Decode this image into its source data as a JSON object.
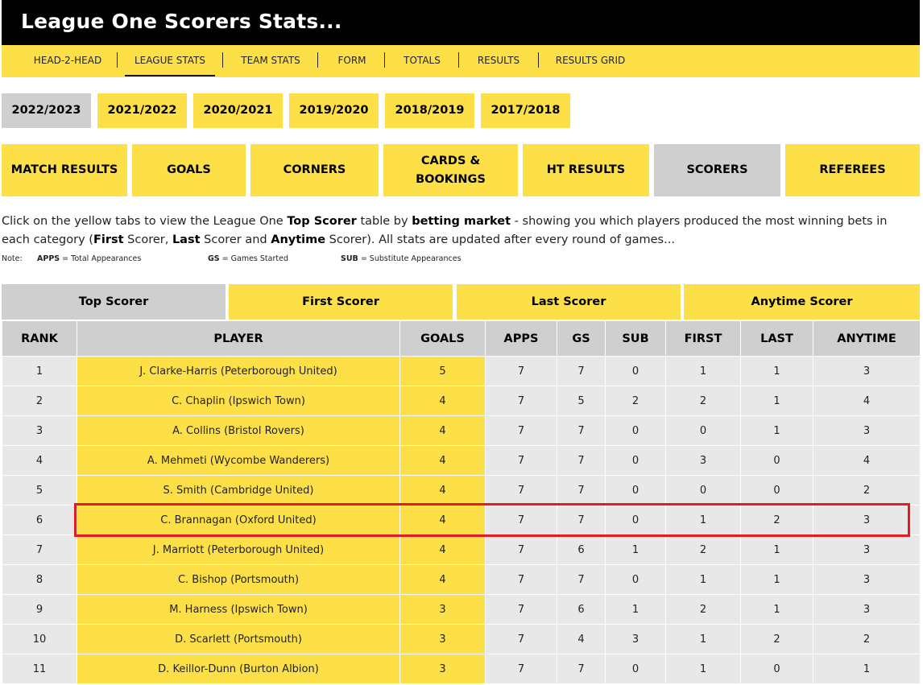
{
  "header": {
    "title": "League One Scorers Stats..."
  },
  "nav": {
    "items": [
      {
        "label": "HEAD-2-HEAD",
        "active": false
      },
      {
        "label": "LEAGUE STATS",
        "active": true
      },
      {
        "label": "TEAM STATS",
        "active": false
      },
      {
        "label": "FORM",
        "active": false
      },
      {
        "label": "TOTALS",
        "active": false
      },
      {
        "label": "RESULTS",
        "active": false
      },
      {
        "label": "RESULTS GRID",
        "active": false
      }
    ]
  },
  "seasons": [
    {
      "label": "2022/2023",
      "active": true
    },
    {
      "label": "2021/2022",
      "active": false
    },
    {
      "label": "2020/2021",
      "active": false
    },
    {
      "label": "2019/2020",
      "active": false
    },
    {
      "label": "2018/2019",
      "active": false
    },
    {
      "label": "2017/2018",
      "active": false
    }
  ],
  "categories": [
    {
      "label": "MATCH RESULTS",
      "active": false
    },
    {
      "label": "GOALS",
      "active": false
    },
    {
      "label": "CORNERS",
      "active": false
    },
    {
      "label": "CARDS & BOOKINGS",
      "active": false
    },
    {
      "label": "HT RESULTS",
      "active": false
    },
    {
      "label": "SCORERS",
      "active": true
    },
    {
      "label": "REFEREES",
      "active": false
    }
  ],
  "description": {
    "t1": "Click on the yellow tabs to view the League One ",
    "b1": "Top Scorer",
    "t2": " table by ",
    "b2": "betting market",
    "t3": " - showing you which players produced the most winning bets in each category (",
    "b3": "First",
    "t4": " Scorer, ",
    "b4": "Last",
    "t5": " Scorer and ",
    "b5": "Anytime",
    "t6": " Scorer). All stats are updated after every round of games..."
  },
  "note": {
    "prefix": "Note:",
    "apps_key": "APPS",
    "apps_text": " = Total Appearances",
    "gs_key": "GS",
    "gs_text": " = Games Started",
    "sub_key": "SUB",
    "sub_text": " = Substitute Appearances"
  },
  "sub_tabs": [
    {
      "label": "Top Scorer",
      "active": true
    },
    {
      "label": "First Scorer",
      "active": false
    },
    {
      "label": "Last Scorer",
      "active": false
    },
    {
      "label": "Anytime Scorer",
      "active": false
    }
  ],
  "table": {
    "headers": [
      "RANK",
      "PLAYER",
      "GOALS",
      "APPS",
      "GS",
      "SUB",
      "FIRST",
      "LAST",
      "ANYTIME"
    ],
    "rows": [
      [
        "1",
        "J. Clarke-Harris (Peterborough United)",
        "5",
        "7",
        "7",
        "0",
        "1",
        "1",
        "3"
      ],
      [
        "2",
        "C. Chaplin (Ipswich Town)",
        "4",
        "7",
        "5",
        "2",
        "2",
        "1",
        "4"
      ],
      [
        "3",
        "A. Collins (Bristol Rovers)",
        "4",
        "7",
        "7",
        "0",
        "0",
        "1",
        "3"
      ],
      [
        "4",
        "A. Mehmeti (Wycombe Wanderers)",
        "4",
        "7",
        "7",
        "0",
        "3",
        "0",
        "4"
      ],
      [
        "5",
        "S. Smith (Cambridge United)",
        "4",
        "7",
        "7",
        "0",
        "0",
        "0",
        "2"
      ],
      [
        "6",
        "C. Brannagan (Oxford United)",
        "4",
        "7",
        "7",
        "0",
        "1",
        "2",
        "3"
      ],
      [
        "7",
        "J. Marriott (Peterborough United)",
        "4",
        "7",
        "6",
        "1",
        "2",
        "1",
        "3"
      ],
      [
        "8",
        "C. Bishop (Portsmouth)",
        "4",
        "7",
        "7",
        "0",
        "1",
        "1",
        "3"
      ],
      [
        "9",
        "M. Harness (Ipswich Town)",
        "3",
        "7",
        "6",
        "1",
        "2",
        "1",
        "3"
      ],
      [
        "10",
        "D. Scarlett (Portsmouth)",
        "3",
        "7",
        "4",
        "3",
        "1",
        "2",
        "2"
      ],
      [
        "11",
        "D. Keillor-Dunn (Burton Albion)",
        "3",
        "7",
        "7",
        "0",
        "1",
        "0",
        "1"
      ]
    ],
    "highlighted_rank": "6"
  },
  "colors": {
    "accent_yellow": "#fde048",
    "active_grey": "#cfcfcf",
    "row_grey": "#e8e8e8",
    "header_black": "#000000",
    "highlight_red": "#e51b24"
  }
}
